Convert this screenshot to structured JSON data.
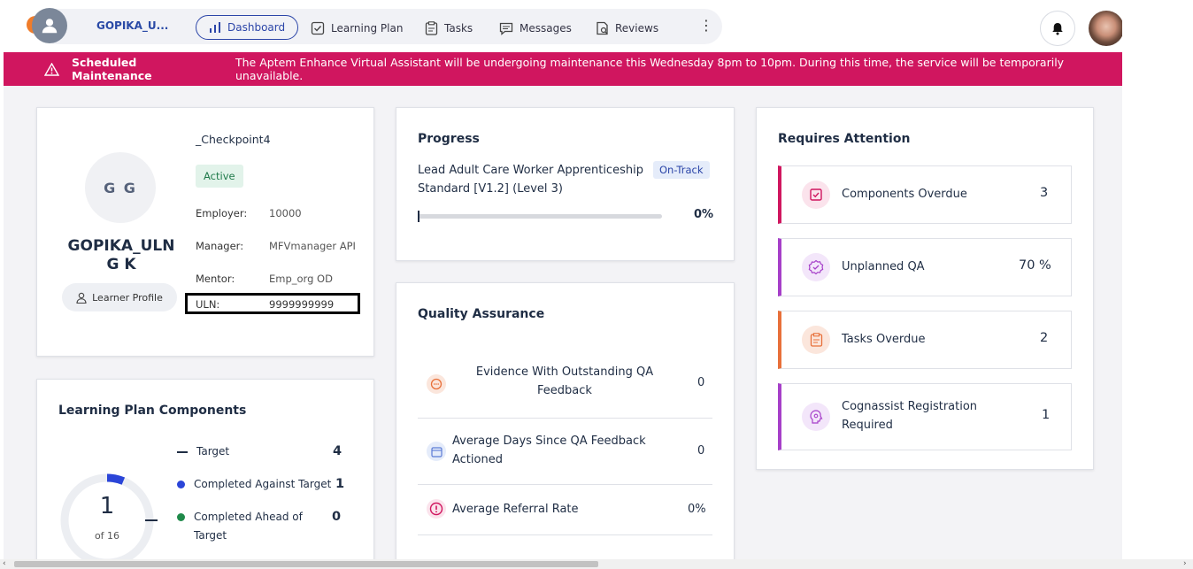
{
  "nav": {
    "user_short": "GOPIKA_U...",
    "items": [
      {
        "label": "Dashboard",
        "icon": "bar-chart-icon"
      },
      {
        "label": "Learning Plan",
        "icon": "checkbox-icon"
      },
      {
        "label": "Tasks",
        "icon": "clipboard-icon"
      },
      {
        "label": "Messages",
        "icon": "message-icon"
      },
      {
        "label": "Reviews",
        "icon": "review-icon"
      }
    ]
  },
  "banner": {
    "title": "Scheduled Maintenance",
    "message": "The Aptem Enhance Virtual Assistant will be undergoing maintenance this Wednesday 8pm to 10pm. During this time, the service will be temporarily unavailable."
  },
  "profile": {
    "initials": "G G",
    "name": "GOPIKA_ULN G K",
    "learner_profile_label": "Learner Profile",
    "programme": "_Checkpoint4",
    "status": "Active",
    "employer_label": "Employer:",
    "employer": "10000",
    "manager_label": "Manager:",
    "manager": "MFVmanager API",
    "mentor_label": "Mentor:",
    "mentor": "Emp_org OD",
    "uln_label": "ULN:",
    "uln": "9999999999"
  },
  "progress": {
    "title": "Progress",
    "standard": "Lead Adult Care Worker Apprenticeship Standard [V1.2] (Level 3)",
    "status": "On-Track",
    "percent_label": "0%",
    "percent": 0
  },
  "qa": {
    "title": "Quality Assurance",
    "rows": [
      {
        "label": "Evidence With Outstanding QA Feedback",
        "value": "0"
      },
      {
        "label": "Average Days Since QA Feedback Actioned",
        "value": "0"
      },
      {
        "label": "Average Referral Rate",
        "value": "0%"
      }
    ]
  },
  "attention": {
    "title": "Requires Attention",
    "items": [
      {
        "label": "Components Overdue",
        "value": "3",
        "color": "#d0165f"
      },
      {
        "label": "Unplanned QA",
        "value": "70 %",
        "color": "#a63fc9"
      },
      {
        "label": "Tasks Overdue",
        "value": "2",
        "color": "#e8703a"
      },
      {
        "label": "Cognassist Registration Required",
        "value": "1",
        "color": "#a63fc9"
      }
    ]
  },
  "learning_plan": {
    "title": "Learning Plan Components",
    "center_value": "1",
    "center_sub": "of 16",
    "legend": [
      {
        "label": "Target",
        "value": "4",
        "color": "#1f2d44"
      },
      {
        "label": "Completed Against Target",
        "value": "1",
        "color": "#2b45d8"
      },
      {
        "label": "Completed Ahead of Target",
        "value": "0",
        "color": "#1f8a4a"
      }
    ]
  }
}
